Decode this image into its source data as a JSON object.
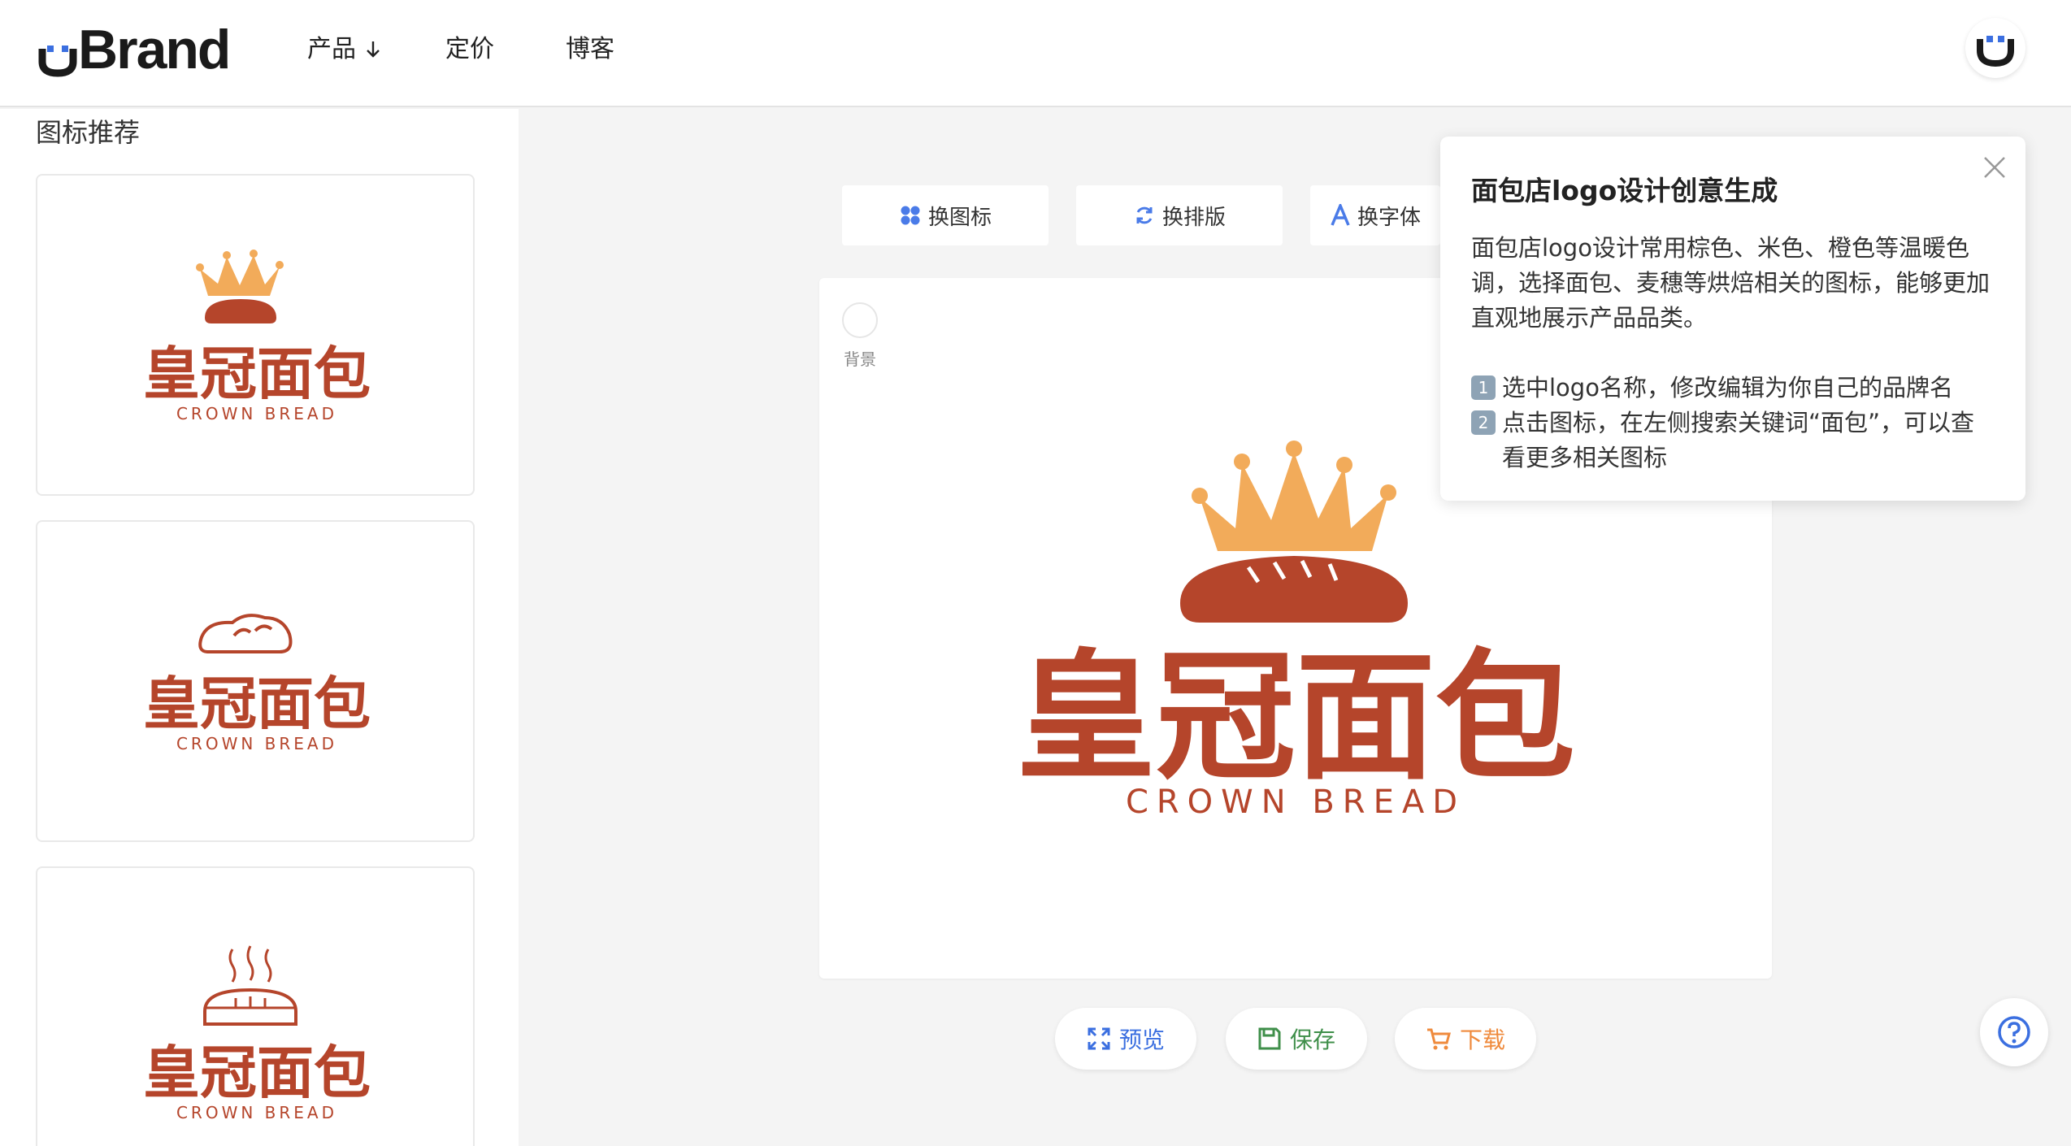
{
  "header": {
    "brand": "Brand",
    "nav": [
      {
        "label": "产品"
      },
      {
        "label": "定价"
      },
      {
        "label": "博客"
      }
    ]
  },
  "sidebar": {
    "title": "图标推荐",
    "cards": [
      {
        "name_cn": "皇冠面包",
        "name_en": "CROWN BREAD",
        "icon": "crown-bread-icon"
      },
      {
        "name_cn": "皇冠面包",
        "name_en": "CROWN BREAD",
        "icon": "bread-outline-icon"
      },
      {
        "name_cn": "皇冠面包",
        "name_en": "CROWN BREAD",
        "icon": "steaming-bread-icon"
      }
    ]
  },
  "toolbar": {
    "change_icon": "换图标",
    "change_layout": "换排版",
    "change_font": "换字体"
  },
  "canvas": {
    "bg_label": "背景",
    "name_cn": "皇冠面包",
    "name_en": "CROWN BREAD"
  },
  "actions": {
    "preview": "预览",
    "save": "保存",
    "download": "下载"
  },
  "popover": {
    "title": "面包店logo设计创意生成",
    "body": "面包店logo设计常用棕色、米色、橙色等温暖色调，选择面包、麦穗等烘焙相关的图标，能够更加直观地展示产品品类。",
    "steps": [
      {
        "num": "1",
        "text": "选中logo名称，修改编辑为你自己的品牌名"
      },
      {
        "num": "2",
        "text": "点击图标，在左侧搜索关键词“面包”，可以查看更多相关图标"
      }
    ]
  },
  "colors": {
    "brand_red": "#b5452b",
    "crown_orange": "#f2ab5a",
    "accent_blue": "#3b6fe0",
    "save_green": "#3f8f4a",
    "download_orange": "#ef8a3c"
  }
}
